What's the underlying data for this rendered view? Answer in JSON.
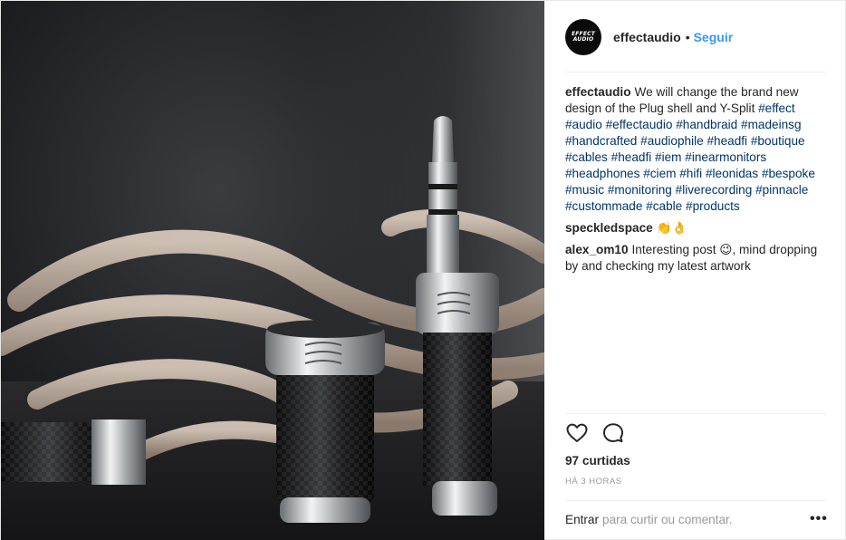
{
  "post": {
    "author": {
      "username": "effectaudio",
      "avatar_text": "EFFECT AUDIO"
    },
    "separator": "•",
    "follow_label": "Seguir",
    "caption": {
      "username": "effectaudio",
      "text": "We will change the brand new design of the Plug shell and Y-Split",
      "hashtags": [
        "#effect",
        "#audio",
        "#effectaudio",
        "#handbraid",
        "#madeinsg",
        "#handcrafted",
        "#audiophile",
        "#headfi",
        "#boutique",
        "#cables",
        "#headfi",
        "#iem",
        "#inearmonitors",
        "#headphones",
        "#ciem",
        "#hifi",
        "#leonidas",
        "#bespoke",
        "#music",
        "#monitoring",
        "#liverecording",
        "#pinnacle",
        "#custommade",
        "#cable",
        "#products"
      ]
    },
    "comments": [
      {
        "username": "speckledspace",
        "text": "👏👌"
      },
      {
        "username": "alex_om10",
        "text": "Interesting post 😉, mind dropping by and checking my latest artwork"
      }
    ],
    "icons": {
      "like": "heart-outline-icon",
      "comment": "speech-bubble-icon",
      "more": "more-options-icon"
    },
    "likes_label": "97 curtidas",
    "time_ago": "HÁ 3 HORAS",
    "comment_bar": {
      "login_link": "Entrar",
      "rest": "para curtir ou comentar.",
      "more_label": "•••"
    }
  }
}
